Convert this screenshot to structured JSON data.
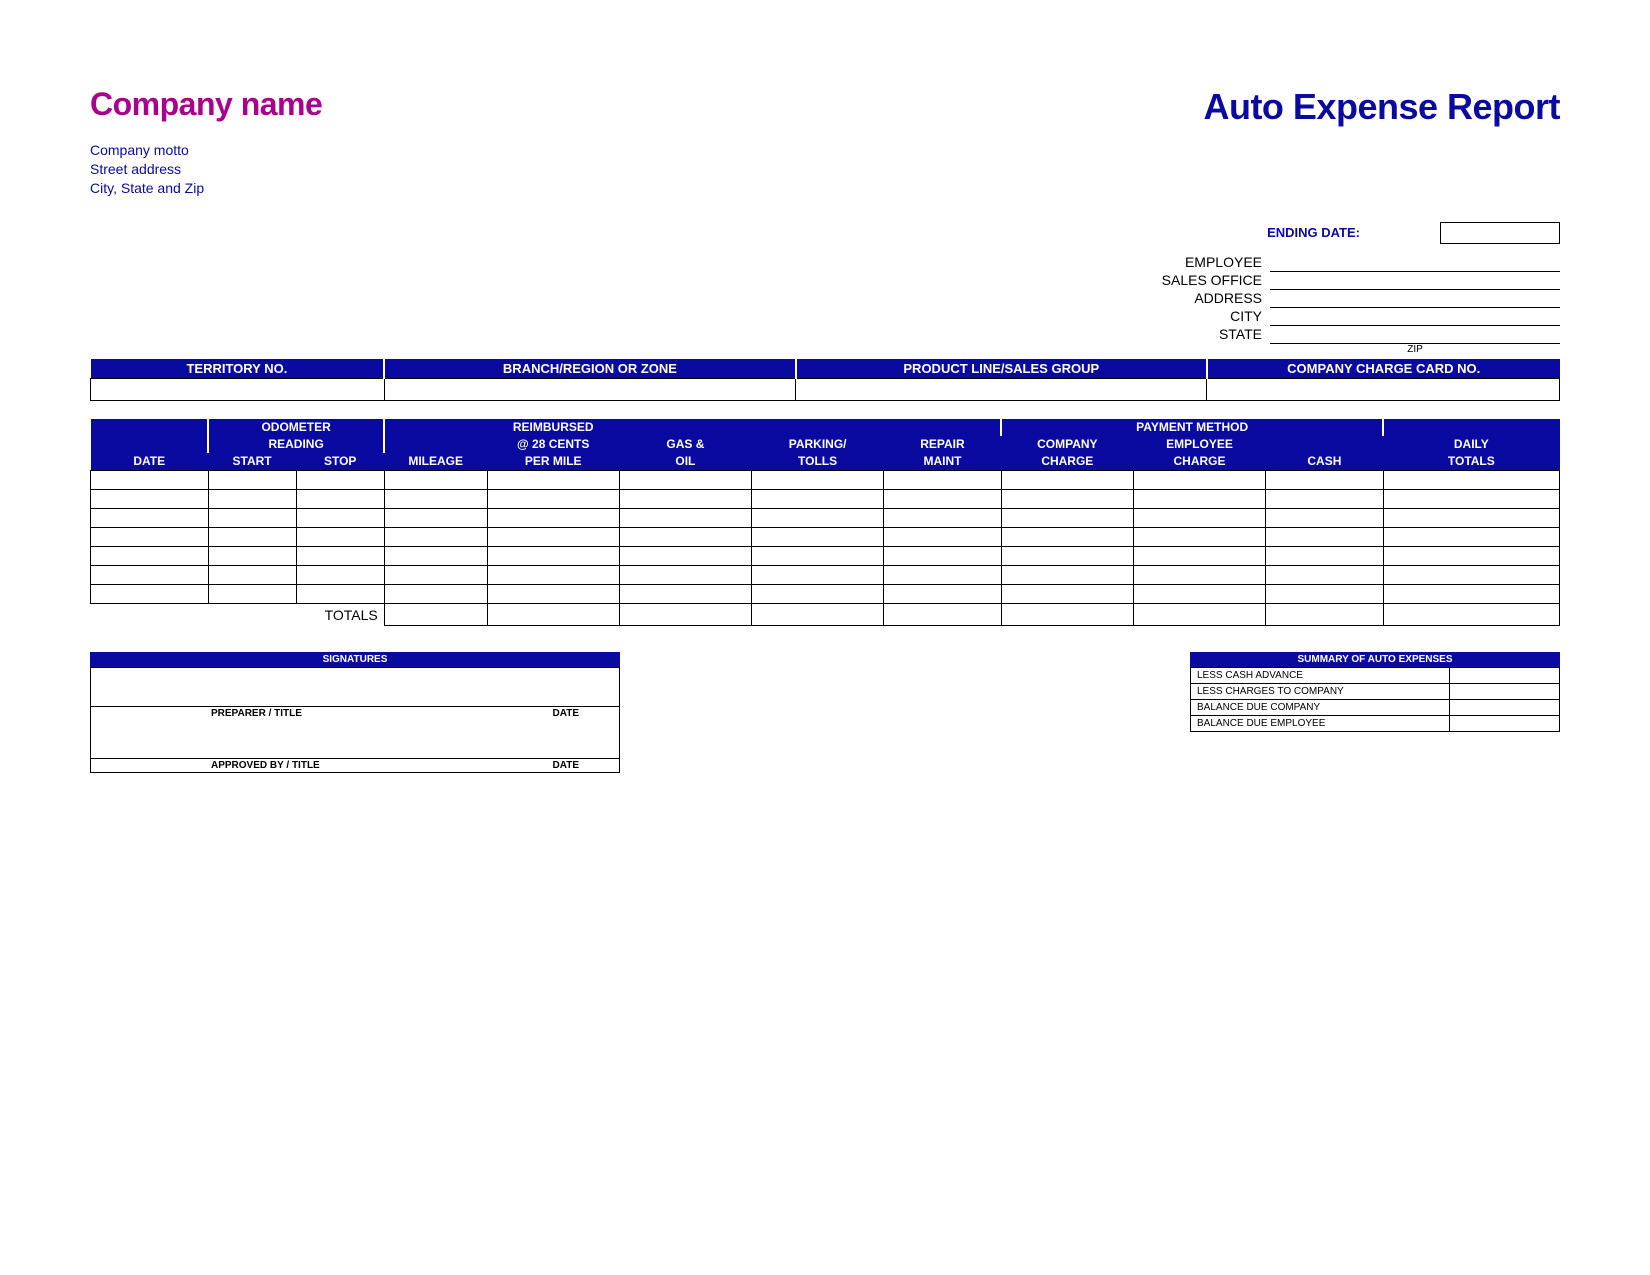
{
  "header": {
    "company_name": "Company name",
    "report_title": "Auto Expense Report",
    "motto": "Company motto",
    "street": "Street address",
    "city_state_zip": "City, State and Zip"
  },
  "meta": {
    "ending_date_label": "ENDING DATE:",
    "employee_label": "EMPLOYEE",
    "sales_office_label": "SALES OFFICE",
    "address_label": "ADDRESS",
    "city_label": "CITY",
    "state_label": "STATE",
    "zip_label": "ZIP"
  },
  "section1": {
    "h1": "TERRITORY NO.",
    "h2": "BRANCH/REGION OR ZONE",
    "h3": "PRODUCT LINE/SALES GROUP",
    "h4": "COMPANY CHARGE CARD NO."
  },
  "grid": {
    "odometer_span": "ODOMETER",
    "reading_span": "READING",
    "reimb_l1": "REIMBURSED",
    "reimb_l2": "@ 28 CENTS",
    "reimb_l3": "PER MILE",
    "payment_span": "PAYMENT METHOD",
    "date": "DATE",
    "start": "START",
    "stop": "STOP",
    "mileage": "MILEAGE",
    "gas_l1": "GAS &",
    "gas_l2": "OIL",
    "park_l1": "PARKING/",
    "park_l2": "TOLLS",
    "repair_l1": "REPAIR",
    "repair_l2": "MAINT",
    "company_l1": "COMPANY",
    "company_l2": "CHARGE",
    "employee_l1": "EMPLOYEE",
    "employee_l2": "CHARGE",
    "cash": "CASH",
    "daily_l1": "DAILY",
    "daily_l2": "TOTALS",
    "totals_label": "TOTALS"
  },
  "signatures": {
    "title": "SIGNATURES",
    "preparer": "PREPARER  /  TITLE",
    "approved": "APPROVED BY  /  TITLE",
    "date": "DATE"
  },
  "summary": {
    "title": "SUMMARY OF AUTO EXPENSES",
    "r1": "LESS CASH ADVANCE",
    "r2": "LESS CHARGES TO COMPANY",
    "r3": "BALANCE DUE COMPANY",
    "r4": "BALANCE DUE EMPLOYEE"
  }
}
